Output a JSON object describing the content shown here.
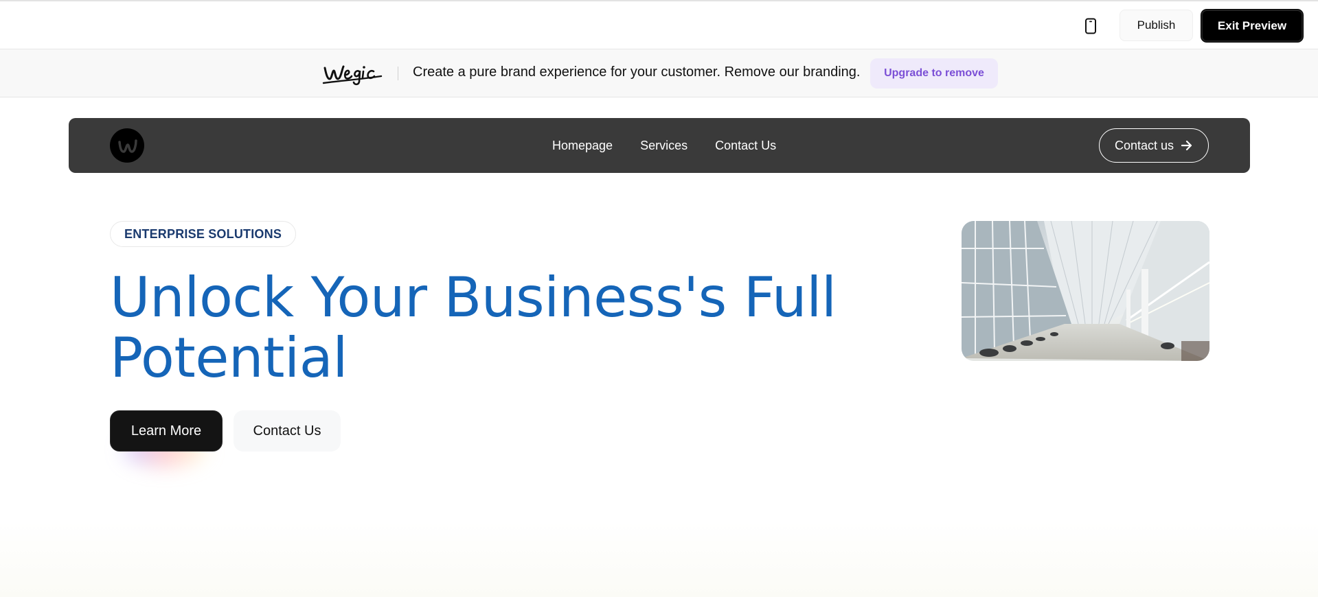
{
  "toolbar": {
    "device_icon": "mobile-device-icon",
    "publish_label": "Publish",
    "exit_label": "Exit Preview"
  },
  "banner": {
    "logo_text": "wegic",
    "message": "Create a pure brand experience for your customer. Remove our branding.",
    "upgrade_label": "Upgrade to remove",
    "accent_color": "#7b4fd6"
  },
  "nav": {
    "logo_icon": "wegic-circle-logo",
    "links": [
      "Homepage",
      "Services",
      "Contact Us"
    ],
    "cta_label": "Contact us",
    "cta_icon": "arrow-right-icon"
  },
  "hero": {
    "eyebrow": "ENTERPRISE SOLUTIONS",
    "title": "Unlock Your Business's Full Potential",
    "primary_button": "Learn More",
    "secondary_button": "Contact Us",
    "title_color": "#1565b8",
    "image_subject": "modern-office-atrium"
  }
}
